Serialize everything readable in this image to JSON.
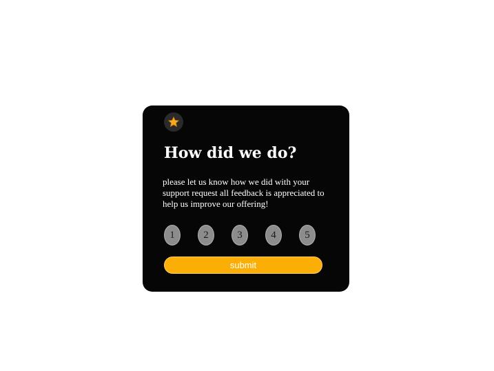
{
  "card": {
    "icon": "star-icon",
    "title": "How did we do?",
    "description": "please let us know how we did with your support request all feedback is appreciated to help us improve our offering!",
    "ratings": [
      "1",
      "2",
      "3",
      "4",
      "5"
    ],
    "submit_label": "submit"
  },
  "colors": {
    "card_background": "#060606",
    "accent": "#fbae06",
    "rating_button": "#8c8c8c",
    "star": "#f9a825"
  }
}
